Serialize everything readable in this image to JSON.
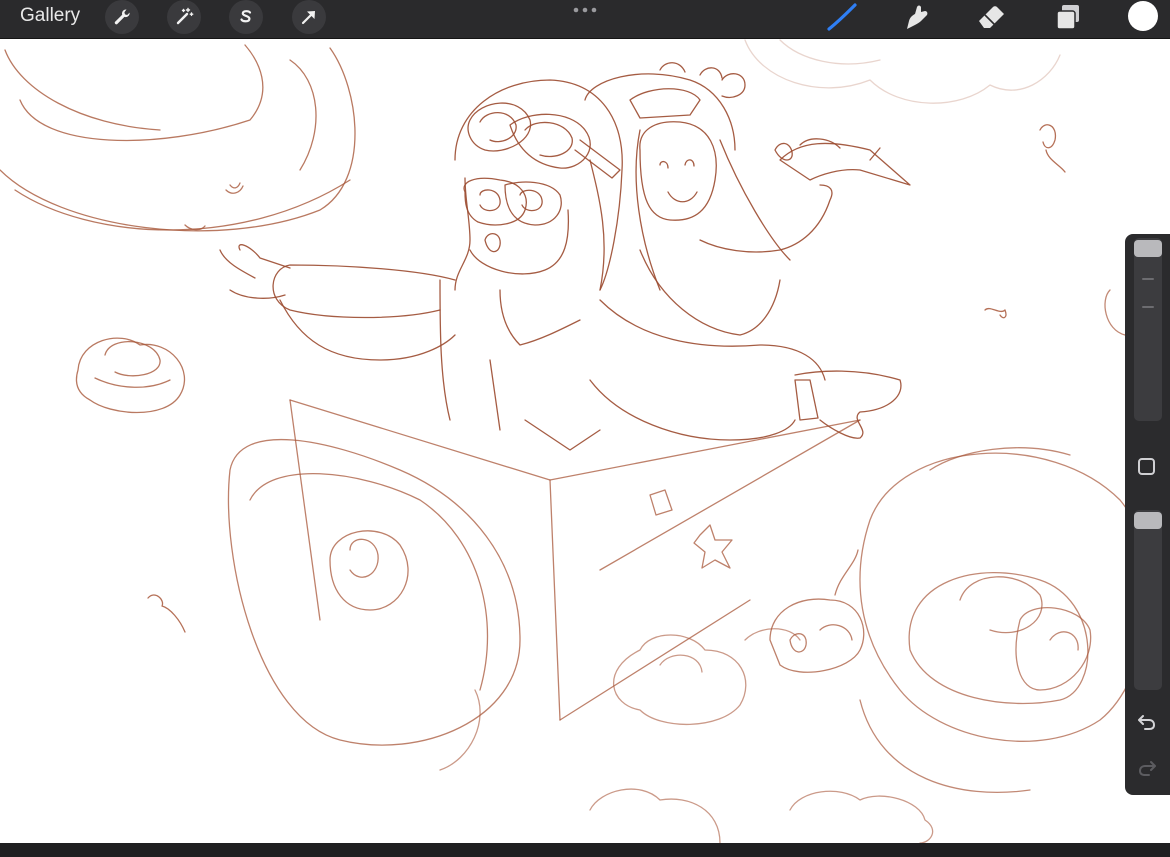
{
  "topbar": {
    "gallery_label": "Gallery",
    "left_tools": [
      "wrench-icon",
      "magic-wand-icon",
      "selection-s-icon",
      "transform-arrow-icon"
    ],
    "center_control": "ellipsis-handle",
    "right_tools": [
      "brush-icon",
      "smudge-icon",
      "eraser-icon",
      "layers-icon"
    ],
    "active_tool": "brush",
    "active_tool_color": "#2f7ff5",
    "current_color": "#ffffff"
  },
  "canvas": {
    "content": "sketch",
    "stroke_color": "#a8573a"
  },
  "sidebar": {
    "brush_size_slider": 1.0,
    "opacity_slider": 1.0,
    "controls": [
      "brush-size-slider",
      "modify-square-button",
      "opacity-slider",
      "undo-button",
      "redo-button"
    ]
  }
}
